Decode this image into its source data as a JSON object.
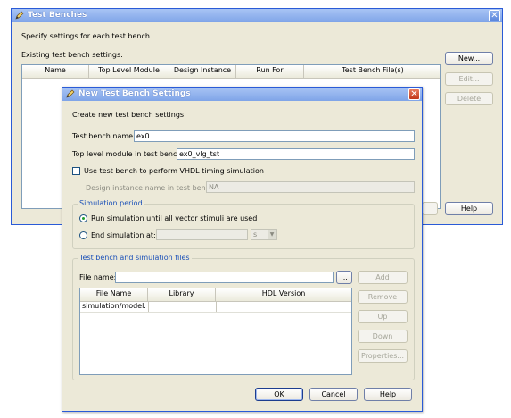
{
  "outer": {
    "title": "Test Benches",
    "description": "Specify settings for each test bench.",
    "existing_label": "Existing test bench settings:",
    "columns": [
      "Name",
      "Top Level Module",
      "Design Instance",
      "Run For",
      "Test Bench File(s)"
    ],
    "buttons": {
      "new": "New...",
      "edit": "Edit...",
      "delete": "Delete",
      "help": "Help"
    }
  },
  "dialog": {
    "title": "New Test Bench Settings",
    "description": "Create new test bench settings.",
    "test_bench_name_label": "Test bench name:",
    "test_bench_name_value": "ex0",
    "top_level_label": "Top level module in test bench:",
    "top_level_value": "ex0_vlg_tst",
    "vhdl_checkbox_label": "Use test bench to perform VHDL timing simulation",
    "design_instance_label": "Design instance name in test bench:",
    "design_instance_value": "NA",
    "sim_period": {
      "legend": "Simulation period",
      "run_until_label": "Run simulation until all vector stimuli are used",
      "end_at_label": "End simulation at:",
      "end_at_value": "",
      "unit_value": "s"
    },
    "files": {
      "legend": "Test bench and simulation files",
      "file_name_label": "File name:",
      "file_name_value": "",
      "browse_label": "...",
      "columns": [
        "File Name",
        "Library",
        "HDL Version"
      ],
      "rows": [
        {
          "file": "simulation/model...",
          "library": "",
          "hdl": ""
        }
      ],
      "buttons": {
        "add": "Add",
        "remove": "Remove",
        "up": "Up",
        "down": "Down",
        "properties": "Properties..."
      }
    },
    "buttons": {
      "ok": "OK",
      "cancel": "Cancel",
      "help": "Help"
    }
  },
  "colors": {
    "title_gradient_top": "#a8c4f4",
    "title_gradient_bottom": "#7fa4e8",
    "window_face": "#ece9d8",
    "close_red": "#c1381a",
    "group_legend": "#1a50b8"
  },
  "icons": {
    "title_icon": "pencil-icon",
    "close": "close-icon",
    "dropdown": "chevron-down-icon"
  }
}
